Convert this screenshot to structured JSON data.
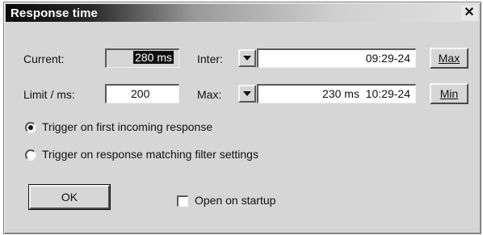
{
  "window": {
    "title": "Response time",
    "close_glyph": "✕"
  },
  "current": {
    "label": "Current:",
    "value": "280 ms"
  },
  "limit": {
    "label": "Limit / ms:",
    "value": "200"
  },
  "inter": {
    "label": "Inter:",
    "value": "09:29-24",
    "button_label": "Max"
  },
  "max": {
    "label": "Max:",
    "value": "230 ms  10:29-24",
    "button_label": "Min"
  },
  "trigger": {
    "option_first": "Trigger on first incoming response",
    "option_matching": "Trigger on response matching filter settings",
    "selected": "first"
  },
  "footer": {
    "ok_label": "OK",
    "startup_label": "Open on startup",
    "startup_checked": false
  },
  "icons": {
    "dropdown": "chevron-down-icon",
    "close": "close-icon"
  }
}
